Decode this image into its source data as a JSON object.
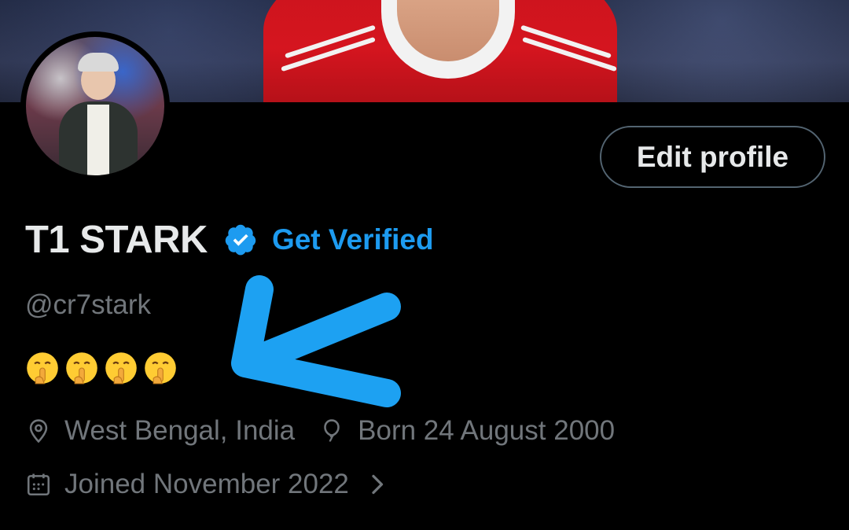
{
  "profile": {
    "display_name": "T1 STARK",
    "handle": "@cr7stark",
    "get_verified_label": "Get Verified",
    "edit_profile_label": "Edit profile",
    "bio_emojis": [
      "shushing-face-emoji",
      "shushing-face-emoji",
      "shushing-face-emoji",
      "shushing-face-emoji"
    ],
    "location": "West Bengal, India",
    "birthday": "Born 24 August 2000",
    "joined": "Joined November 2022"
  },
  "icons": {
    "verified": "verified-badge-icon",
    "location": "location-pin-icon",
    "birthday": "balloon-icon",
    "joined": "calendar-icon",
    "more": "chevron-right-icon"
  },
  "colors": {
    "background": "#000000",
    "accent": "#1d9bf0",
    "annotation_arrow": "#1da1f2",
    "text_primary": "#e7e9ea",
    "text_secondary": "#71767b"
  }
}
